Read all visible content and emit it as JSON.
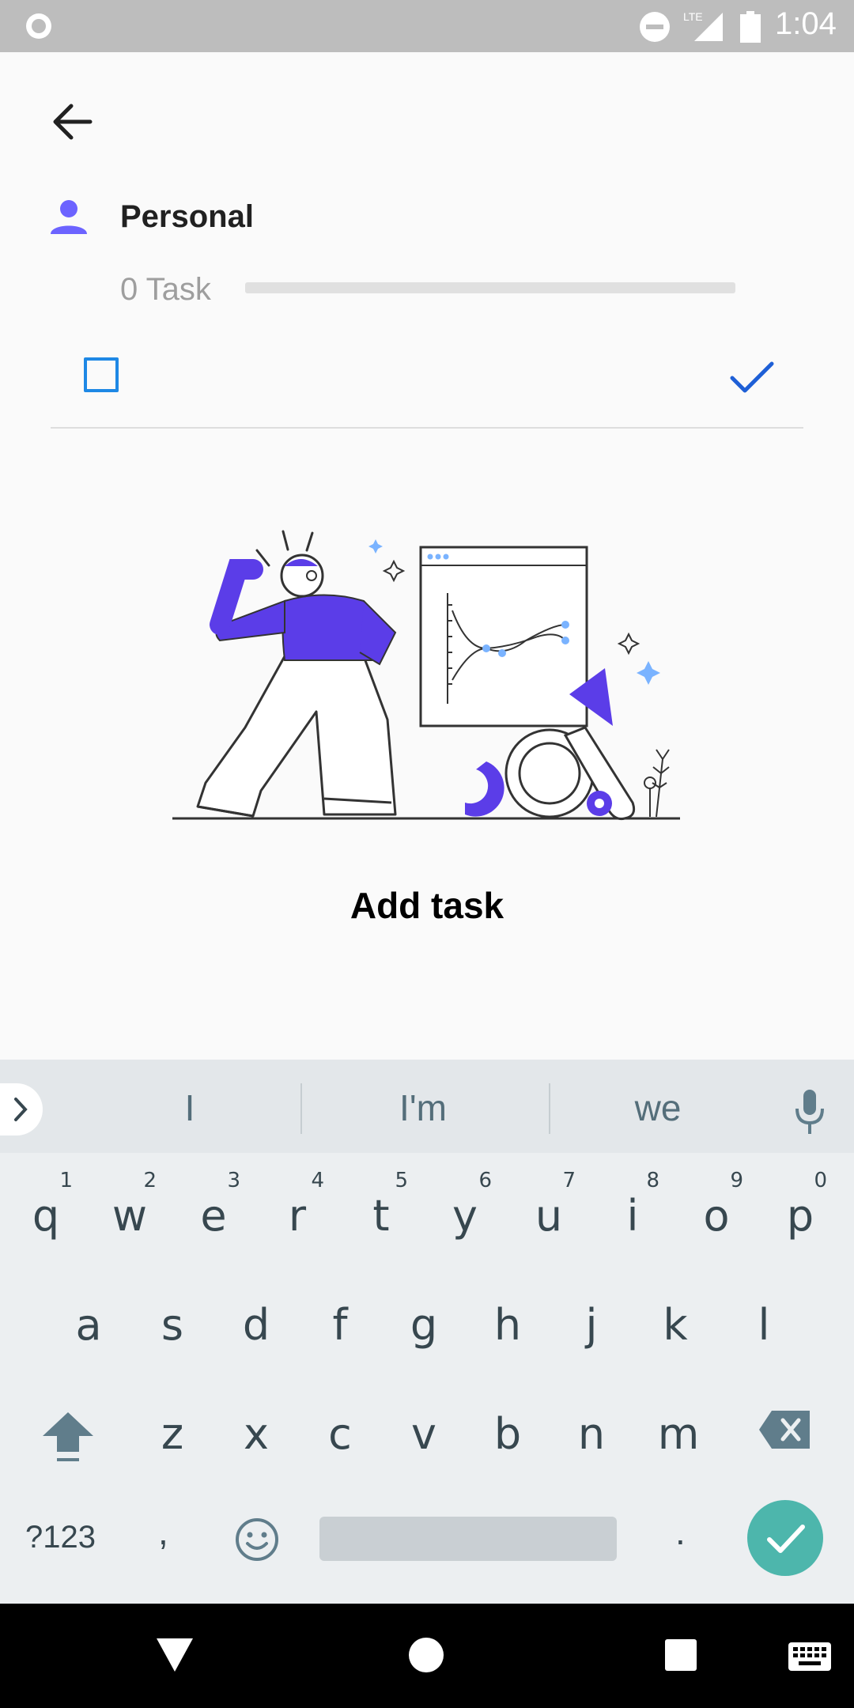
{
  "status_bar": {
    "time": "1:04",
    "network_label": "LTE",
    "icons": [
      "record-icon",
      "do-not-disturb-icon",
      "signal-icon",
      "battery-icon"
    ]
  },
  "header": {
    "back_icon": "arrow-back-icon",
    "list_icon": "person-icon",
    "list_title": "Personal",
    "task_count": "0 Task",
    "progress": 0
  },
  "new_task": {
    "input_value": "",
    "input_placeholder": "",
    "checkbox_checked": false,
    "confirm_icon": "check-icon"
  },
  "empty_state": {
    "title": "Add task",
    "illustration": "confused-person-chart-illustration"
  },
  "keyboard": {
    "suggestions": [
      "I",
      "I'm",
      "we"
    ],
    "row1": [
      {
        "k": "q",
        "s": "1"
      },
      {
        "k": "w",
        "s": "2"
      },
      {
        "k": "e",
        "s": "3"
      },
      {
        "k": "r",
        "s": "4"
      },
      {
        "k": "t",
        "s": "5"
      },
      {
        "k": "y",
        "s": "6"
      },
      {
        "k": "u",
        "s": "7"
      },
      {
        "k": "i",
        "s": "8"
      },
      {
        "k": "o",
        "s": "9"
      },
      {
        "k": "p",
        "s": "0"
      }
    ],
    "row2": [
      "a",
      "s",
      "d",
      "f",
      "g",
      "h",
      "j",
      "k",
      "l"
    ],
    "row3": [
      "z",
      "x",
      "c",
      "v",
      "b",
      "n",
      "m"
    ],
    "symbols_label": "?123",
    "comma": ",",
    "period": "."
  },
  "colors": {
    "accent": "#5b4dff",
    "checkbox": "#1e88e5",
    "enter_key": "#4db6ac",
    "illustration_light": "#7ab3ff"
  }
}
